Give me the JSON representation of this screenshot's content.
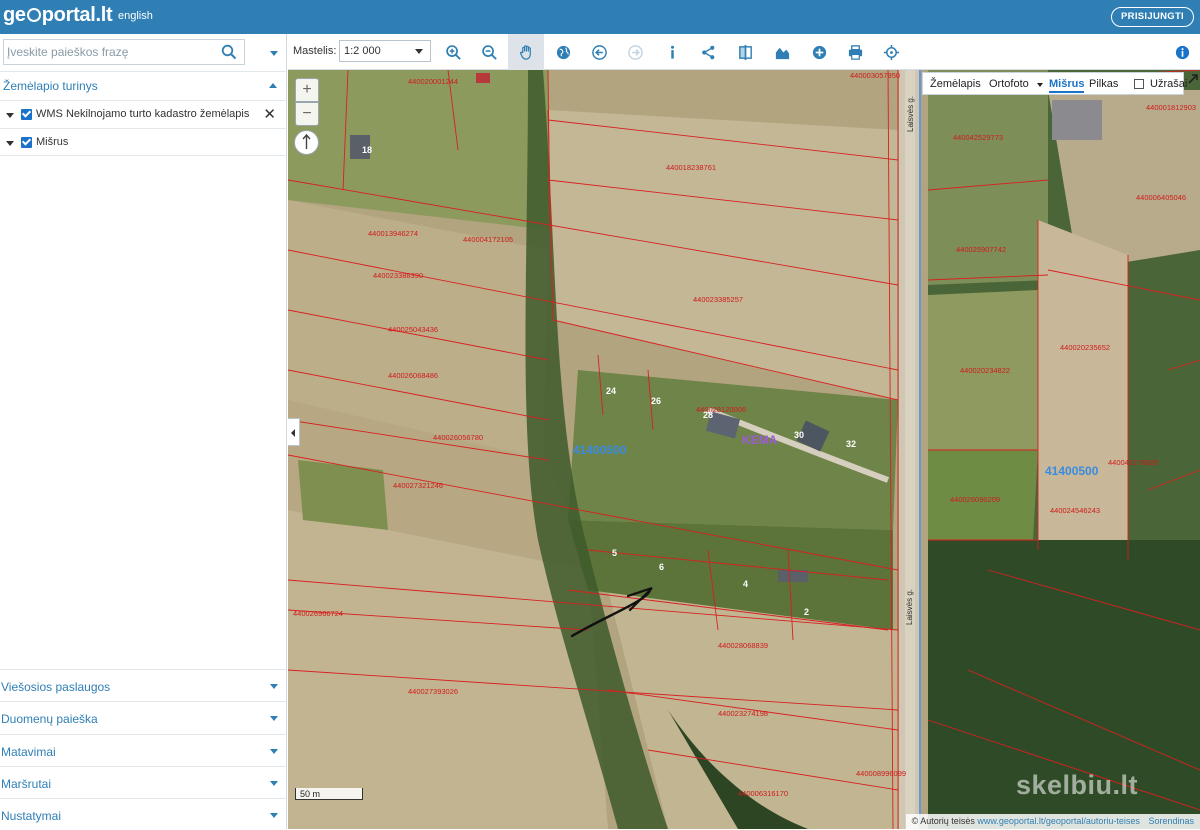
{
  "header": {
    "logo_left": "ge",
    "logo_right": "portal.lt",
    "language": "english",
    "login": "PRISIJUNGTI"
  },
  "search": {
    "placeholder": "Įveskite paieškos frazę"
  },
  "layers": {
    "title": "Žemėlapio turinys",
    "items": [
      {
        "label": "WMS Nekilnojamo turto kadastro žemėlapis",
        "checked": true
      },
      {
        "label": "Mišrus",
        "checked": true
      }
    ]
  },
  "sections": [
    {
      "label": "Viešosios paslaugos"
    },
    {
      "label": "Duomenų paieška"
    },
    {
      "label": "Matavimai"
    },
    {
      "label": "Maršrutai"
    },
    {
      "label": "Nustatymai"
    }
  ],
  "toolbar": {
    "scale_label": "Mastelis:",
    "scale_value": "1:2 000",
    "tools": [
      "zoom-in-icon",
      "zoom-out-icon",
      "pan-hand-icon",
      "globe-icon",
      "back-arrow-icon",
      "forward-arrow-icon",
      "info-icon",
      "share-icon",
      "compare-icon",
      "profile-chart-icon",
      "add-icon",
      "print-icon",
      "locate-crosshair-icon"
    ],
    "help": "info-circle-icon"
  },
  "basemap": {
    "map": "Žemėlapis",
    "ortho": "Ortofoto",
    "mixed": "Mišrus",
    "grey": "Pilkas",
    "labels": "Užrašai"
  },
  "map": {
    "zoom_in": "+",
    "zoom_out": "−",
    "scalebar": "50 m",
    "attribution_prefix": "© Autorių teisės",
    "attribution_link": "www.geoportal.lt/geoportal/autoriu-teises",
    "attribution_suffix": "Sorendinas",
    "watermark": "skelbiu.lt",
    "road_label": "Laisvės g.",
    "street_label_2": "Laisvės g.",
    "district_codes": [
      "41400500",
      "41400500"
    ],
    "purple_label": "KEMA",
    "house_numbers": [
      "18",
      "24",
      "26",
      "28",
      "30",
      "32",
      "5",
      "6",
      "4",
      "2"
    ],
    "parcels": [
      "440020001244",
      "440013946274",
      "440004172105",
      "440023385257",
      "440023388390",
      "440025043436",
      "440026068486",
      "440026056780",
      "440027321246",
      "440026966724",
      "440027393026",
      "440028068839",
      "440023274198",
      "440006316170",
      "440018238761",
      "440042529773",
      "440025907742",
      "440020234822",
      "440020235652",
      "440026090209",
      "440024546243",
      "440001812903",
      "440006405046",
      "440003057950",
      "440008996099",
      "440042176826",
      "440028120006"
    ]
  }
}
